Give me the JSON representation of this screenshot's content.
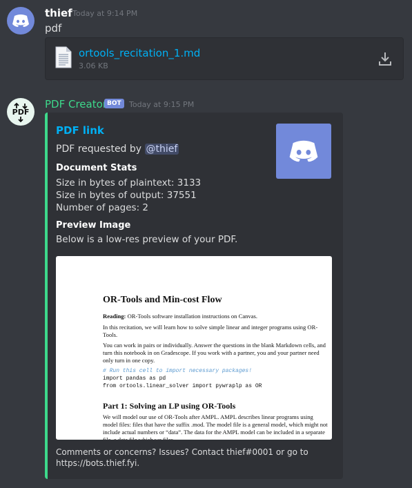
{
  "messages": [
    {
      "username": "thief",
      "timestamp": "Today at 9:14 PM",
      "text": "pdf",
      "attachment": {
        "file_name": "ortools_recitation_1.md",
        "file_size": "3.06 KB"
      }
    },
    {
      "username": "PDF Creator",
      "badge": "BOT",
      "timestamp": "Today at 9:15 PM",
      "embed": {
        "accent_color": "#3dd98b",
        "title": "PDF link",
        "description_prefix": "PDF requested by",
        "mention": "@thief",
        "fields": [
          {
            "name": "Document Stats",
            "lines": [
              "Size in bytes of plaintext: 3133",
              "Size in bytes of output: 37551",
              "Number of pages: 2"
            ]
          },
          {
            "name": "Preview Image",
            "lines": [
              "Below is a low-res preview of your PDF."
            ]
          }
        ],
        "preview": {
          "title": "OR-Tools and Min-cost Flow",
          "reading_label": "Reading:",
          "reading_text": "OR-Tools software installation instructions on Canvas.",
          "para1": "In this recitation, we will learn how to solve simple linear and integer programs using OR-Tools.",
          "para2": "You can work in pairs or individually. Answer the questions in the blank Markdown cells, and turn this notebook in on Gradescope. If you work with a partner, you and your partner need only turn in one copy.",
          "code_comment": "# Run this cell to import necessary packages!",
          "code_line1": "import pandas as pd",
          "code_line2": "from ortools.linear_solver import pywraplp as OR",
          "section_heading": "Part 1: Solving an LP using OR-Tools",
          "para3": "We will model our use of OR-Tools after AMPL. AMPL describes linear programs using model files: files that have the suffix .mod. The model file is a general model, which might not include actual numbers or “data”. The data for the AMPL model can be included in a separate file, a data file which we files"
        },
        "footer": "Comments or concerns? Issues? Contact thief#0001 or go to https://bots.thief.fyi."
      }
    }
  ]
}
